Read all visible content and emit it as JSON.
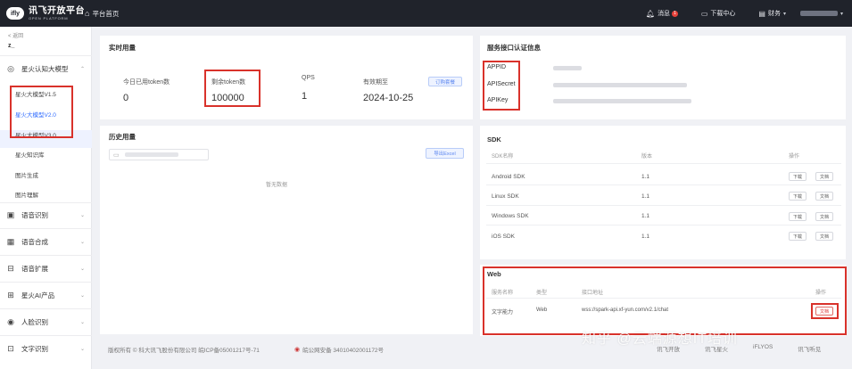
{
  "header": {
    "logo_mark": "ifly",
    "logo_name": "讯飞开放平台",
    "logo_sub": "OPEN PLATFORM",
    "home": "平台首页",
    "messages": "消息",
    "messages_badge": "1",
    "download_center": "下载中心",
    "finance": "财务"
  },
  "sidebar": {
    "back": "< 返回",
    "app_name": "z_",
    "groups": [
      {
        "label": "星火认知大模型"
      },
      {
        "label": "语音识别"
      },
      {
        "label": "语音合成"
      },
      {
        "label": "语音扩展"
      },
      {
        "label": "星火AI产品"
      },
      {
        "label": "人脸识别"
      },
      {
        "label": "文字识别"
      }
    ],
    "subitems": [
      {
        "label": "星火大模型V1.5"
      },
      {
        "label": "星火大模型V2.0"
      },
      {
        "label": "星火大模型V3.0"
      },
      {
        "label": "星火知识库"
      },
      {
        "label": "图片生成"
      },
      {
        "label": "图片理解"
      }
    ]
  },
  "realtime": {
    "title": "实时用量",
    "stats": [
      {
        "label": "今日已用token数",
        "value": "0"
      },
      {
        "label": "剩余token数",
        "value": "100000"
      },
      {
        "label": "QPS",
        "value": "1"
      },
      {
        "label": "有效期至",
        "value": "2024-10-25"
      }
    ],
    "renew_button": "订购套餐"
  },
  "history": {
    "title": "历史用量",
    "export_button": "导出Excel",
    "empty": "暂无数据"
  },
  "credentials": {
    "title": "服务接口认证信息",
    "labels": [
      "APPID",
      "APISecret",
      "APIKey"
    ]
  },
  "sdk": {
    "title": "SDK",
    "headers": [
      "SDK名称",
      "版本",
      "操作"
    ],
    "rows": [
      {
        "name": "Android SDK",
        "version": "1.1"
      },
      {
        "name": "Linux SDK",
        "version": "1.1"
      },
      {
        "name": "Windows SDK",
        "version": "1.1"
      },
      {
        "name": "iOS SDK",
        "version": "1.1"
      }
    ],
    "download_label": "下载",
    "doc_label": "文档"
  },
  "web": {
    "title": "Web",
    "headers": [
      "服务名称",
      "类型",
      "接口地址",
      "操作"
    ],
    "row": {
      "name": "文字能力",
      "type": "Web",
      "url": "wss://spark-api.xf-yun.com/v2.1/chat",
      "action": "文档"
    }
  },
  "footer": {
    "copyright": "版权所有 © 科大讯飞股份有限公司  皖ICP备05001217号-71",
    "police": "皖公网安备 34010402001172号",
    "links": [
      "讯飞开放",
      "讯飞星火",
      "iFLYOS",
      "讯飞听见"
    ]
  },
  "watermark": "知乎 @云端源想IT培训",
  "colors": {
    "topbar": "#20232b",
    "accent": "#2f6bff",
    "highlight_box": "#d9322b"
  }
}
